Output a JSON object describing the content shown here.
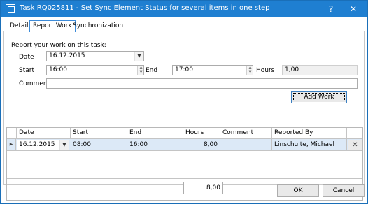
{
  "window": {
    "title": "Task RQ025811 - Set Sync Element Status for several items in one step",
    "help_glyph": "?",
    "close_glyph": "✕"
  },
  "tabs": [
    {
      "label": "Details"
    },
    {
      "label": "Report Work"
    },
    {
      "label": "Synchronization"
    }
  ],
  "form": {
    "heading": "Report your work on this task:",
    "date_label": "Date",
    "date_value": "16.12.2015",
    "start_label": "Start",
    "start_value": "16:00",
    "end_label": "End",
    "end_value": "17:00",
    "hours_label": "Hours",
    "hours_value": "1,00",
    "comment_label": "Comment",
    "comment_value": "",
    "add_work_label": "Add Work"
  },
  "grid": {
    "columns": [
      "Date",
      "Start",
      "End",
      "Hours",
      "Comment",
      "Reported By"
    ],
    "rows": [
      {
        "date": "16.12.2015",
        "start": "08:00",
        "end": "16:00",
        "hours": "8,00",
        "comment": "",
        "reported_by": "Linschulte, Michael"
      }
    ],
    "row_indicator": "▶",
    "delete_glyph": "✕",
    "total": "8,00"
  },
  "buttons": {
    "ok_label": "OK",
    "cancel_label": "Cancel"
  },
  "colors": {
    "titlebar": "#1f7fd1",
    "selected_row": "#dce9f7"
  }
}
